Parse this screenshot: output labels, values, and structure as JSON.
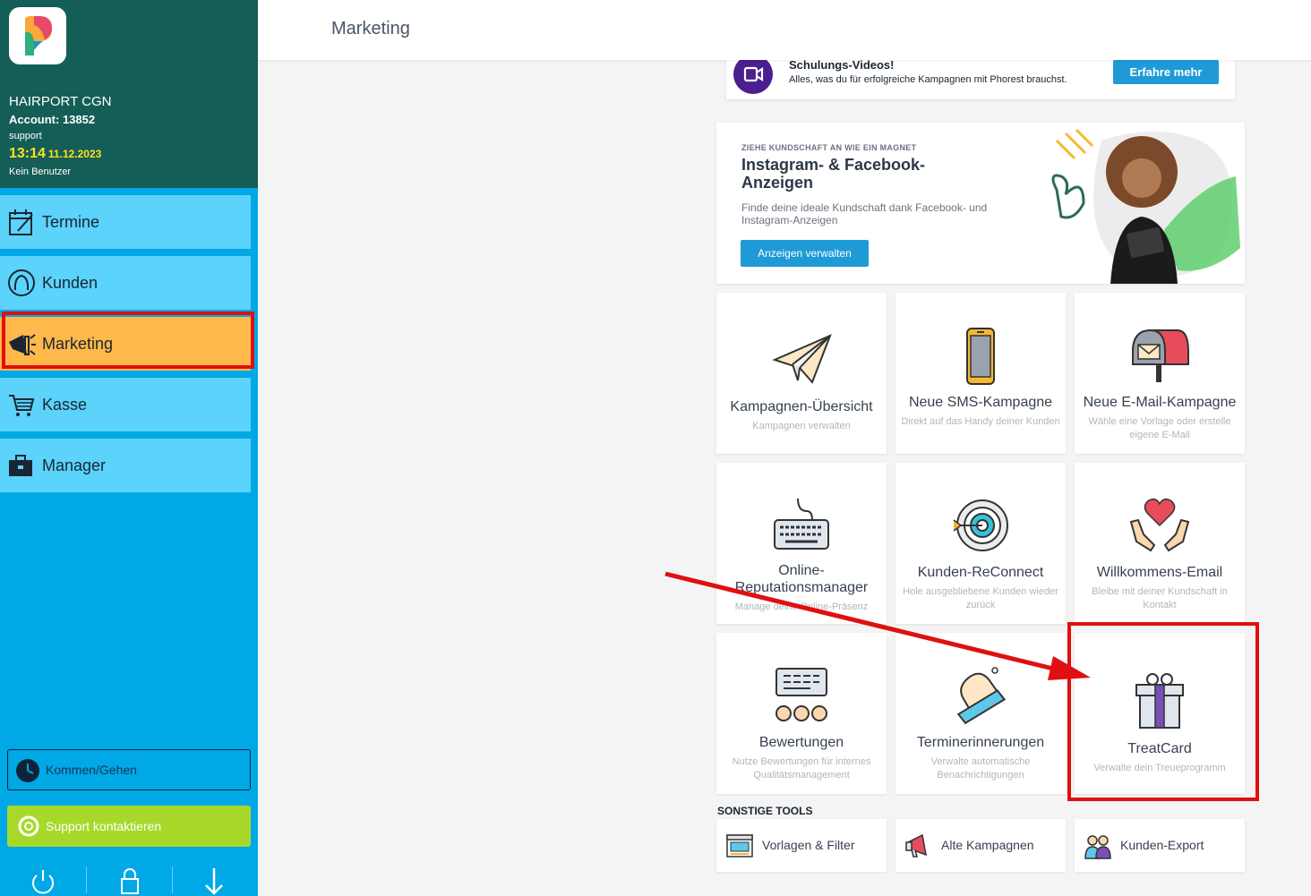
{
  "sidebar": {
    "salon": "HAIRPORT CGN",
    "account": "Account: 13852",
    "role": "support",
    "time": "13:14",
    "date": "11.12.2023",
    "user": "Kein Benutzer",
    "nav": [
      {
        "label": "Termine",
        "icon": "calendar-icon"
      },
      {
        "label": "Kunden",
        "icon": "client-head-icon"
      },
      {
        "label": "Marketing",
        "icon": "megaphone-icon",
        "active": true
      },
      {
        "label": "Kasse",
        "icon": "cart-icon"
      },
      {
        "label": "Manager",
        "icon": "briefcase-icon"
      }
    ],
    "clock_label": "Kommen/Gehen",
    "support_label": "Support kontaktieren",
    "bottom_icons": [
      "power-icon",
      "lock-icon",
      "download-arrow-icon"
    ]
  },
  "header": {
    "title": "Marketing"
  },
  "video": {
    "title": "Schulungs-Videos!",
    "subtitle": "Alles, was du für erfolgreiche Kampagnen mit Phorest brauchst.",
    "button": "Erfahre mehr"
  },
  "ad": {
    "eyebrow": "ZIEHE KUNDSCHAFT AN WIE EIN MAGNET",
    "title": "Instagram- & Facebook-Anzeigen",
    "description": "Finde deine ideale Kundschaft dank Facebook- und Instagram-Anzeigen",
    "button": "Anzeigen verwalten"
  },
  "tiles": [
    {
      "title": "Kampagnen-Übersicht",
      "subtitle": "Kampagnen verwalten",
      "icon": "paper-plane-icon"
    },
    {
      "title": "Neue SMS-Kampagne",
      "subtitle": "Direkt auf das Handy deiner Kunden",
      "icon": "phone-icon"
    },
    {
      "title": "Neue E-Mail-Kampagne",
      "subtitle": "Wähle eine Vorlage oder erstelle eigene E-Mail",
      "icon": "mailbox-icon"
    },
    {
      "title": "Online-Reputationsmanager",
      "subtitle": "Manage deine Online-Präsenz",
      "icon": "keyboard-icon"
    },
    {
      "title": "Kunden-ReConnect",
      "subtitle": "Hole ausgebliebene Kunden wieder zurück",
      "icon": "target-icon"
    },
    {
      "title": "Willkommens-Email",
      "subtitle": "Bleibe mit deiner Kundschaft in Kontakt",
      "icon": "heart-hands-icon"
    },
    {
      "title": "Bewertungen",
      "subtitle": "Nutze Bewertungen für internes Qualitätsmanagement",
      "icon": "reviews-icon"
    },
    {
      "title": "Terminerinnerungen",
      "subtitle": "Verwalte automatische Benachrichtigungen",
      "icon": "bell-icon"
    },
    {
      "title": "TreatCard",
      "subtitle": "Verwalte dein Treueprogramm",
      "icon": "gift-icon"
    }
  ],
  "tools": {
    "title": "SONSTIGE TOOLS",
    "items": [
      {
        "label": "Vorlagen & Filter",
        "icon": "template-icon"
      },
      {
        "label": "Alte Kampagnen",
        "icon": "megaphone-icon"
      },
      {
        "label": "Kunden-Export",
        "icon": "people-export-icon"
      }
    ]
  },
  "colors": {
    "sidebar": "#00a8e6",
    "header": "#155e57",
    "nav": "#5bd3fa",
    "active": "#ffb84a",
    "accent": "#1e9bd6",
    "highlight": "#e01010"
  }
}
